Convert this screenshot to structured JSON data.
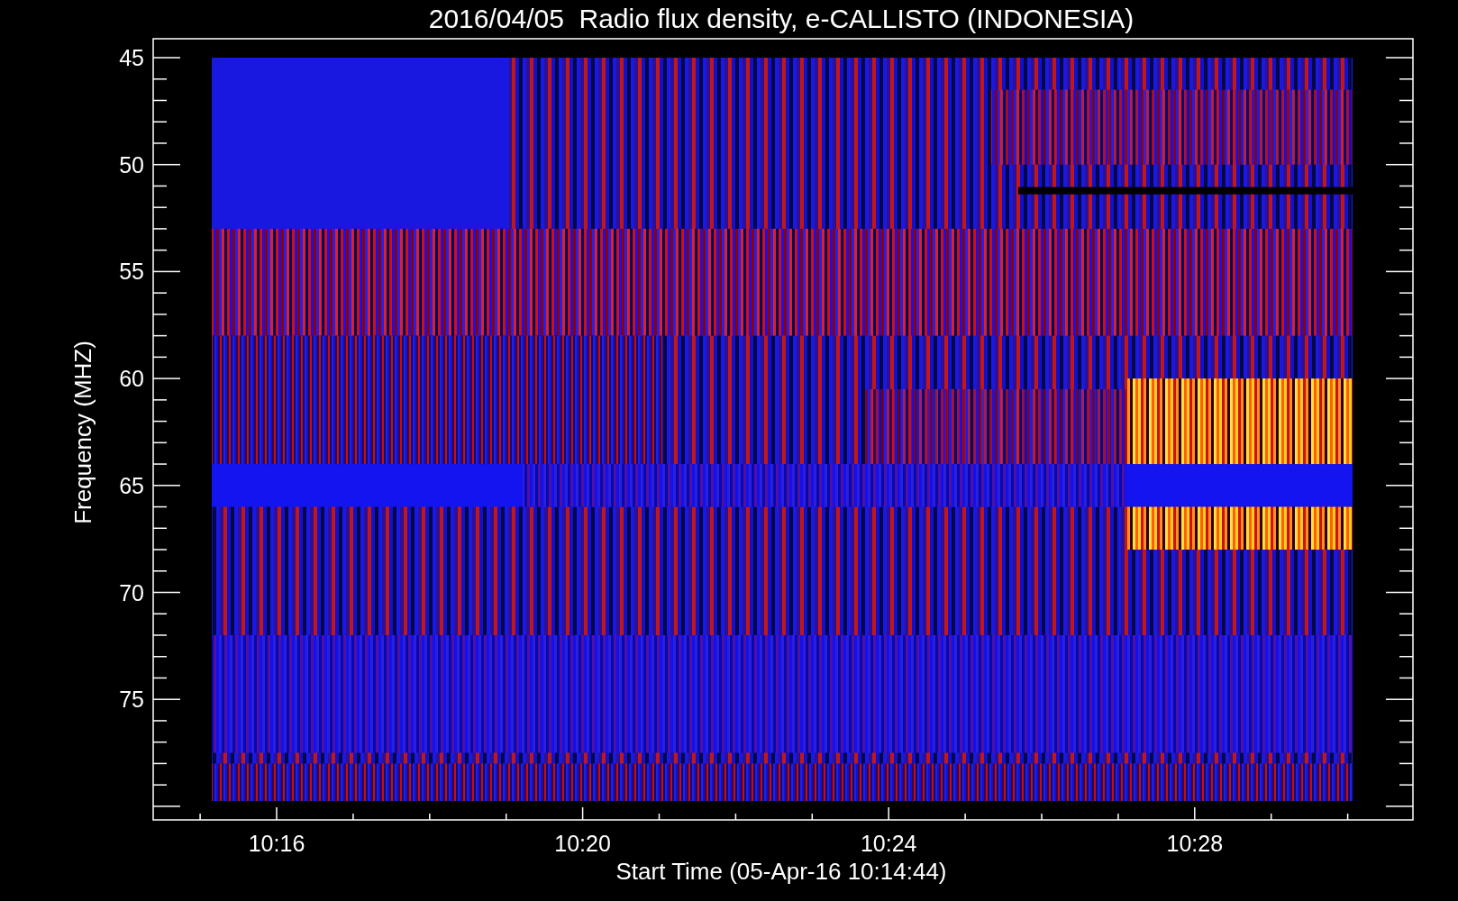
{
  "title": "2016/04/05  Radio flux density, e-CALLISTO (INDONESIA)",
  "y_axis": {
    "label": "Frequency (MHZ)",
    "ticks": [
      "45",
      "50",
      "55",
      "60",
      "65",
      "70",
      "75"
    ]
  },
  "x_axis": {
    "label": "Start Time (05-Apr-16 10:14:44)",
    "ticks": [
      "10:16",
      "10:20",
      "10:24",
      "10:28"
    ]
  }
}
